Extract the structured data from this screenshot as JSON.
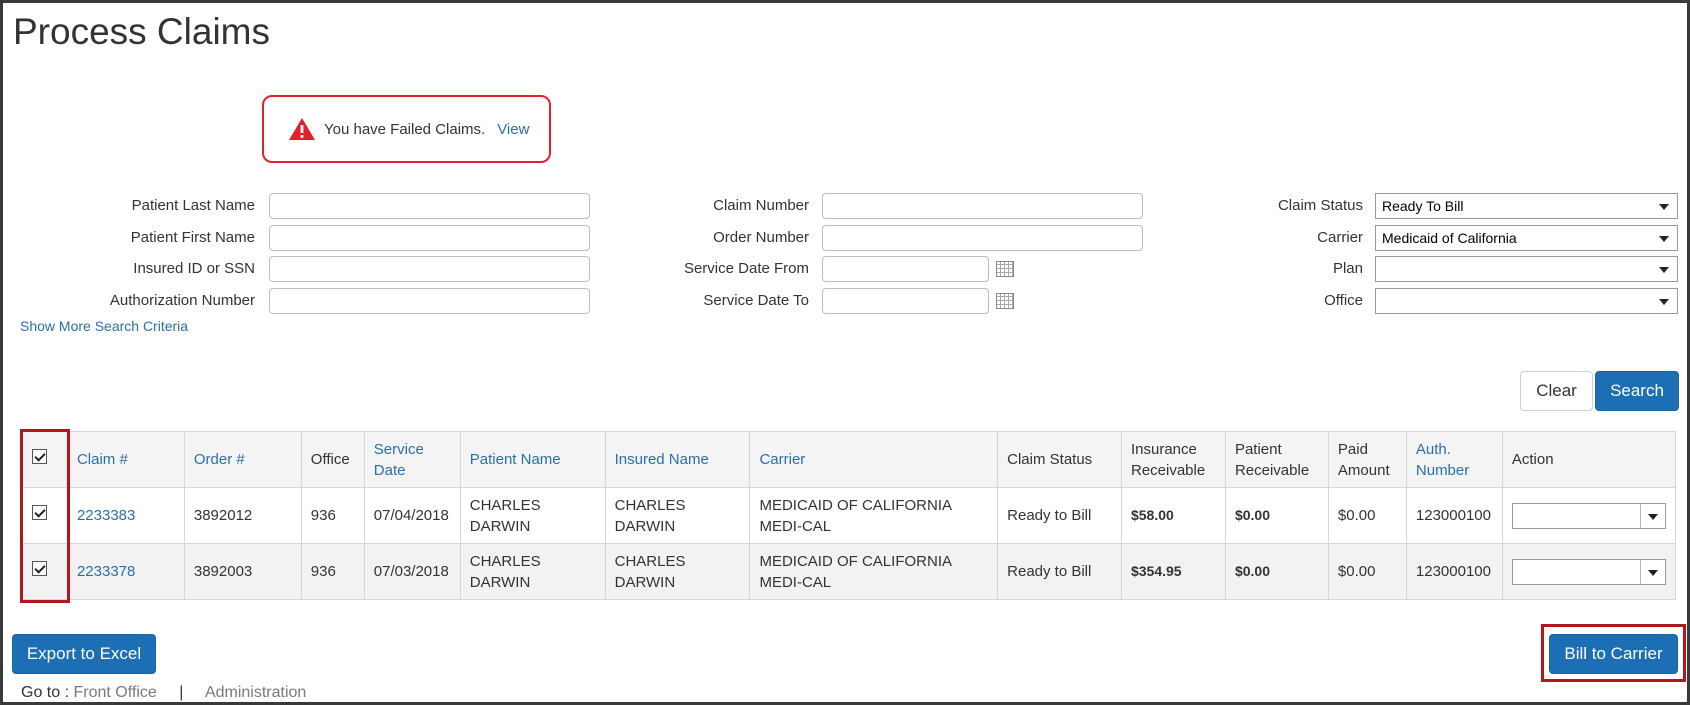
{
  "page_title": "Process Claims",
  "alert": {
    "message": "You have Failed Claims.",
    "link": "View"
  },
  "search": {
    "left": [
      {
        "label": "Patient Last Name",
        "value": ""
      },
      {
        "label": "Patient First Name",
        "value": ""
      },
      {
        "label": "Insured ID or SSN",
        "value": ""
      },
      {
        "label": "Authorization Number",
        "value": ""
      }
    ],
    "middle": [
      {
        "label": "Claim Number",
        "value": ""
      },
      {
        "label": "Order Number",
        "value": ""
      },
      {
        "label": "Service Date From",
        "value": ""
      },
      {
        "label": "Service Date To",
        "value": ""
      }
    ],
    "right": [
      {
        "label": "Claim Status",
        "value": "Ready To Bill"
      },
      {
        "label": "Carrier",
        "value": "Medicaid of California"
      },
      {
        "label": "Plan",
        "value": ""
      },
      {
        "label": "Office",
        "value": ""
      }
    ],
    "show_more": "Show More Search Criteria",
    "clear_label": "Clear",
    "search_label": "Search"
  },
  "table": {
    "headers": [
      "Claim #",
      "Order #",
      "Office",
      "Service Date",
      "Patient Name",
      "Insured Name",
      "Carrier",
      "Claim Status",
      "Insurance Receivable",
      "Patient Receivable",
      "Paid Amount",
      "Auth. Number",
      "Action"
    ],
    "rows": [
      {
        "checked": true,
        "claim": "2233383",
        "order": "3892012",
        "office": "936",
        "service_date": "07/04/2018",
        "patient": "CHARLES DARWIN",
        "insured": "CHARLES DARWIN",
        "carrier_line1": "MEDICAID OF CALIFORNIA",
        "carrier_line2": "MEDI-CAL",
        "status": "Ready to Bill",
        "ins_recv": "$58.00",
        "pat_recv": "$0.00",
        "paid": "$0.00",
        "auth": "123000100",
        "action": ""
      },
      {
        "checked": true,
        "claim": "2233378",
        "order": "3892003",
        "office": "936",
        "service_date": "07/03/2018",
        "patient": "CHARLES DARWIN",
        "insured": "CHARLES DARWIN",
        "carrier_line1": "MEDICAID OF CALIFORNIA",
        "carrier_line2": "MEDI-CAL",
        "status": "Ready to Bill",
        "ins_recv": "$354.95",
        "pat_recv": "$0.00",
        "paid": "$0.00",
        "auth": "123000100",
        "action": ""
      }
    ]
  },
  "export_label": "Export to Excel",
  "bill_label": "Bill to Carrier",
  "footer": {
    "goto": "Go to :",
    "front_office": "Front Office",
    "separator": "|",
    "administration": "Administration"
  },
  "colors": {
    "primary": "#1d6fb5",
    "link": "#2a6fb0",
    "alert_border": "#e2222a",
    "highlight": "#b3161d"
  },
  "icons": {
    "alert": "warning-triangle-icon",
    "calendar": "calendar-icon",
    "dropdown": "caret-down-icon"
  }
}
